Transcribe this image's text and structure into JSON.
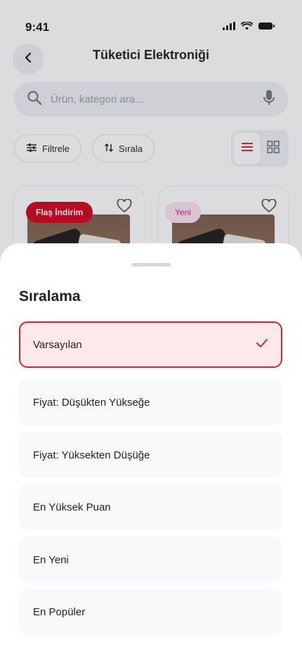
{
  "status_bar": {
    "time": "9:41"
  },
  "header": {
    "title": "Tüketici Elektroniği"
  },
  "search": {
    "placeholder": "Ürün, kategori ara..."
  },
  "toolbar": {
    "filter_label": "Filtrele",
    "sort_label": "Sırala"
  },
  "products": [
    {
      "badge": "Flaş İndirim"
    },
    {
      "badge": "Yeni"
    }
  ],
  "sort_sheet": {
    "title": "Sıralama",
    "options": [
      {
        "label": "Varsayılan",
        "selected": true
      },
      {
        "label": "Fiyat: Düşükten Yükseğe"
      },
      {
        "label": "Fiyat: Yüksekten Düşüğe"
      },
      {
        "label": "En Yüksek Puan"
      },
      {
        "label": "En Yeni"
      },
      {
        "label": "En Popüler"
      }
    ]
  },
  "colors": {
    "accent": "#d02536",
    "selected_bg": "#fde8ea",
    "badge_red": "#d0021b",
    "badge_pink_bg": "#fbe3ef",
    "badge_pink_text": "#d81b76"
  }
}
